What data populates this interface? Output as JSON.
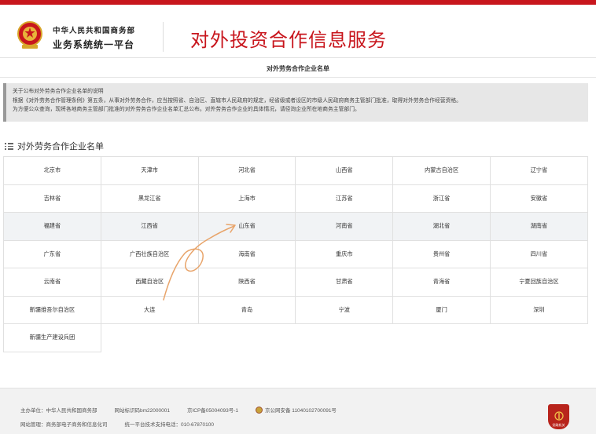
{
  "header": {
    "ministry": "中华人民共和国商务部",
    "platform": "业务系统统一平台",
    "site_title": "对外投资合作信息服务"
  },
  "page_title": "对外劳务合作企业名单",
  "notice": {
    "lines": [
      "关于公布对外劳务合作企业名单的说明",
      "根据《对外劳务合作管理条例》第五条，从事对外劳务合作，应当按照省、自治区、直辖市人民政府的规定，经省级或者设区的市级人民政府商务主管部门批准，取得对外劳务合作经营资格。",
      "为方便公众查询，现将各地商务主管部门批准的对外劳务合作企业名单汇总公布。对外劳务合作企业的具体情况，请径询企业所在地商务主管部门。"
    ]
  },
  "section_title": "对外劳务合作企业名单",
  "regions": [
    [
      "北京市",
      "天津市",
      "河北省",
      "山西省",
      "内蒙古自治区",
      "辽宁省"
    ],
    [
      "吉林省",
      "黑龙江省",
      "上海市",
      "江苏省",
      "浙江省",
      "安徽省"
    ],
    [
      "福建省",
      "江西省",
      "山东省",
      "河南省",
      "湖北省",
      "湖南省"
    ],
    [
      "广东省",
      "广西壮族自治区",
      "海南省",
      "重庆市",
      "贵州省",
      "四川省"
    ],
    [
      "云南省",
      "西藏自治区",
      "陕西省",
      "甘肃省",
      "青海省",
      "宁夏回族自治区"
    ],
    [
      "新疆维吾尔自治区",
      "大连",
      "青岛",
      "宁波",
      "厦门",
      "深圳"
    ],
    [
      "新疆生产建设兵团"
    ]
  ],
  "footer": {
    "sponsor": "主办单位：中华人民共和国商务部",
    "site_code": "网站标识码bm22000001",
    "icp": "京ICP备05004093号-1",
    "police": "京公网安备 11040102700091号",
    "manager": "网站管理：商务部电子商务和信息化司",
    "support": "统一平台技术支持电话：010-67870100",
    "badge_text": "党政机关"
  },
  "colors": {
    "brand_red": "#c8161d"
  }
}
